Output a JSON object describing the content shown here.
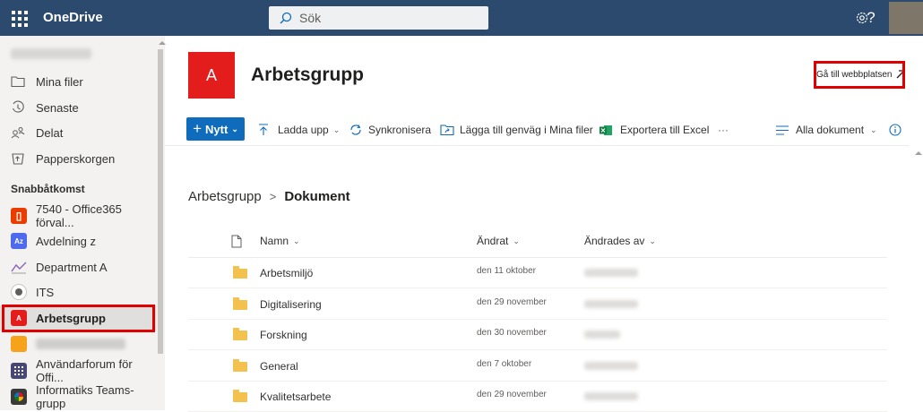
{
  "topbar": {
    "brand": "OneDrive",
    "search_placeholder": "Sök",
    "settings_icon": "gear-icon",
    "help": "?",
    "bg": "#2c4a6e"
  },
  "sidebar": {
    "nav": [
      {
        "label": "Mina filer",
        "icon": "folder-icon"
      },
      {
        "label": "Senaste",
        "icon": "clock-icon"
      },
      {
        "label": "Delat",
        "icon": "people-icon"
      },
      {
        "label": "Papperskorgen",
        "icon": "recycle-bin-icon"
      }
    ],
    "section_label": "Snabbåtkomst",
    "quick": [
      {
        "label": "7540 - Office365 förval...",
        "badge": "O",
        "color": "#eb3c00"
      },
      {
        "label": "Avdelning z",
        "badge": "Az",
        "color": "#4f6bed"
      },
      {
        "label": "Department A",
        "badge": "",
        "color": "#8a8886"
      },
      {
        "label": "ITS",
        "badge": "",
        "color": "#605e5c"
      },
      {
        "label": "Arbetsgrupp",
        "badge": "A",
        "color": "#e31c1c"
      },
      {
        "label": "",
        "badge": "",
        "color": "#f7a21b"
      },
      {
        "label": "Användarforum för Offi...",
        "badge": "",
        "color": "#464775"
      },
      {
        "label": "Informatiks Teams-grupp",
        "badge": "",
        "color": "#3a3a3a"
      }
    ]
  },
  "site": {
    "logo_letter": "A",
    "title": "Arbetsgrupp",
    "goto_label": "Gå till webbplatsen",
    "accent": "#e31c1c"
  },
  "commands": {
    "new_label": "Nytt",
    "upload_label": "Ladda upp",
    "sync_label": "Synkronisera",
    "shortcut_label": "Lägga till genväg i Mina filer",
    "export_label": "Exportera till Excel",
    "more_label": "···",
    "view_label": "Alla dokument"
  },
  "breadcrumb": {
    "parent": "Arbetsgrupp",
    "separator": ">",
    "current": "Dokument"
  },
  "list": {
    "columns": {
      "name": "Namn",
      "modified": "Ändrat",
      "modified_by": "Ändrades av"
    },
    "rows": [
      {
        "name": "Arbetsmiljö",
        "modified": "den 11 oktober"
      },
      {
        "name": "Digitalisering",
        "modified": "den 29 november"
      },
      {
        "name": "Forskning",
        "modified": "den 30 november"
      },
      {
        "name": "General",
        "modified": "den 7 oktober"
      },
      {
        "name": "Kvalitetsarbete",
        "modified": "den 29 november"
      }
    ]
  }
}
